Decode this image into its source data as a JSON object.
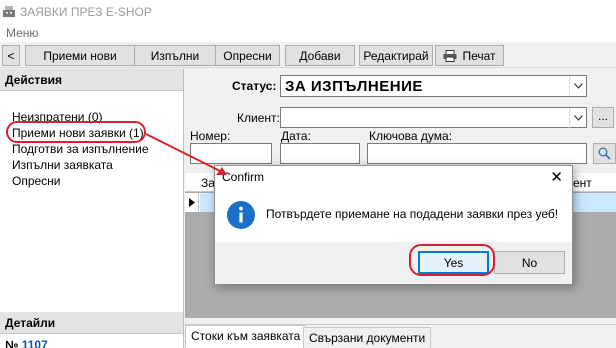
{
  "window": {
    "title": "ЗАЯВКИ ПРЕЗ E-SHOP",
    "icon": "cash-register-icon"
  },
  "menu": {
    "items": [
      "Меню"
    ]
  },
  "toolbar": {
    "back_label": "<",
    "buttons": [
      "Приеми нови",
      "Изпълни",
      "Опресни",
      "Добави",
      "Редактирай",
      "Печат"
    ],
    "print_icon": "printer-icon"
  },
  "actions_panel": {
    "header": "Действия",
    "items": [
      "Неизпратени (0)",
      "Приеми нови заявки (1)",
      "Подготви за изпълнение",
      "Изпълни заявката",
      "Опресни"
    ]
  },
  "details_panel": {
    "header": "Детайли",
    "number_prefix": "№",
    "number_value": "1107"
  },
  "filters": {
    "status_label": "Статус:",
    "status_value": "ЗА ИЗПЪЛНЕНИЕ",
    "client_label": "Клиент:",
    "client_value": "",
    "ellipsis_label": "...",
    "number_label": "Номер:",
    "date_label": "Дата:",
    "keyword_label": "Ключова дума:",
    "search_icon": "magnifier-icon"
  },
  "grid": {
    "columns_visible": [
      "За",
      "ент"
    ],
    "row_indicator": "▶"
  },
  "tabs": [
    "Стоки към заявката",
    "Свързани документи"
  ],
  "dialog": {
    "title": "Confirm",
    "close_label": "✕",
    "message": "Потвърдете приемане на подадени заявки през уеб!",
    "icon": "info-icon",
    "yes_label": "Yes",
    "no_label": "No"
  },
  "colors": {
    "annotation": "#d62130",
    "info_icon": "#1a6fc7",
    "selected_row": "#cce8ff",
    "default_button_border": "#0078d7"
  }
}
